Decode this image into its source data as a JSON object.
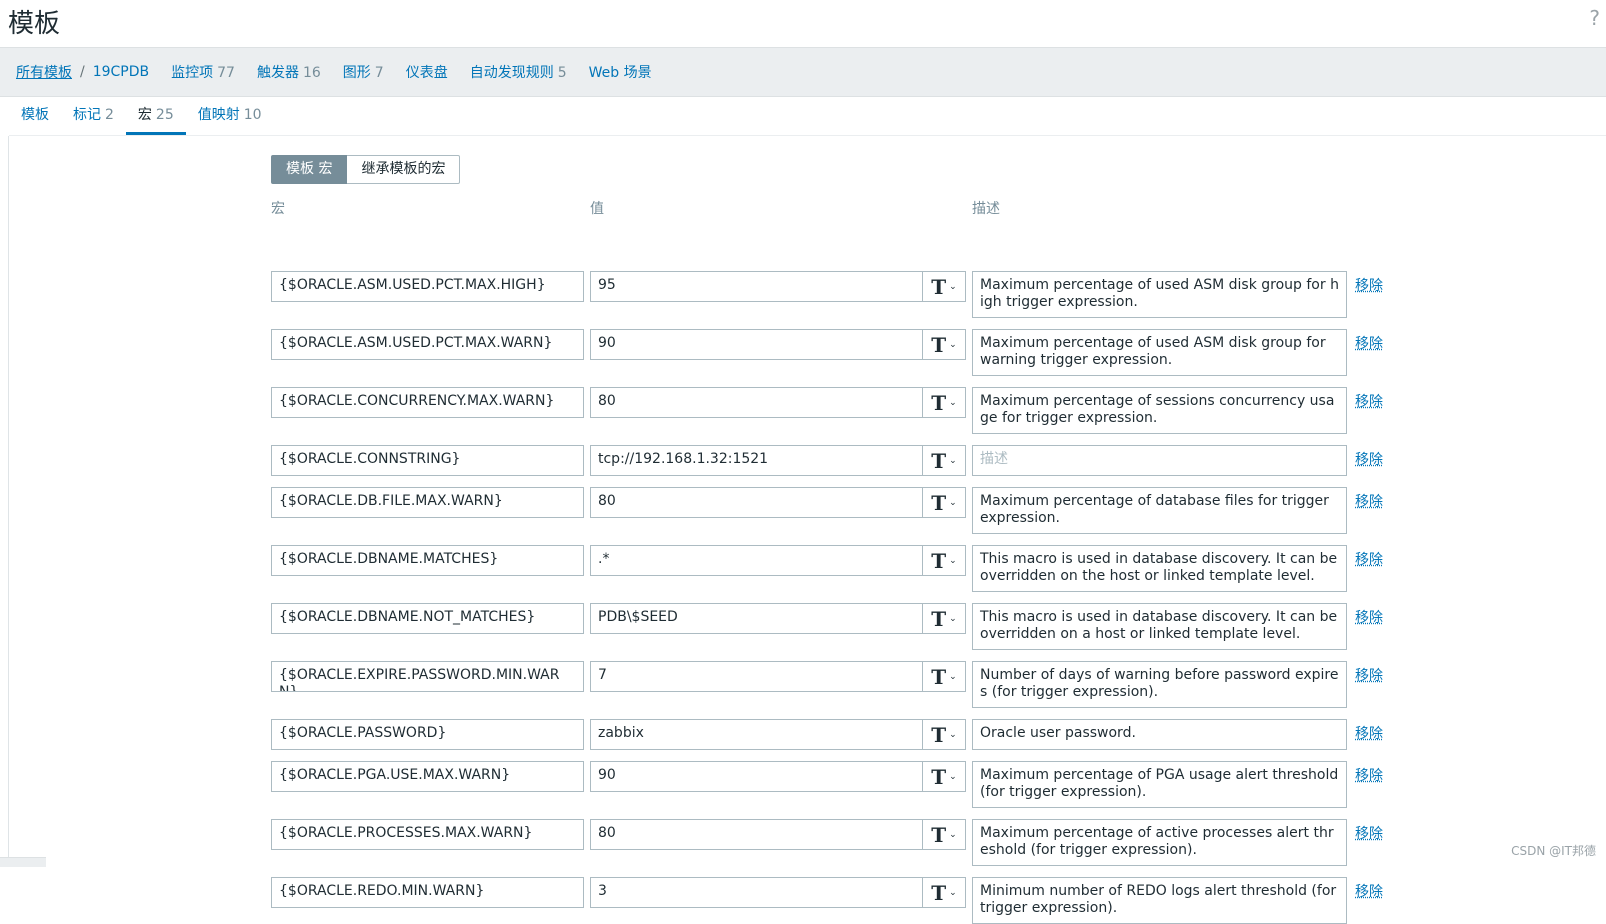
{
  "page": {
    "title": "模板",
    "help": "?"
  },
  "nav": {
    "all_templates": "所有模板",
    "sep": "/",
    "current": "19CPDB",
    "items": [
      {
        "label": "监控项",
        "count": "77"
      },
      {
        "label": "触发器",
        "count": "16"
      },
      {
        "label": "图形",
        "count": "7"
      },
      {
        "label": "仪表盘",
        "count": ""
      },
      {
        "label": "自动发现规则",
        "count": "5"
      },
      {
        "label": "Web 场景",
        "count": ""
      }
    ]
  },
  "tabs": [
    {
      "label": "模板",
      "count": ""
    },
    {
      "label": "标记",
      "count": "2"
    },
    {
      "label": "宏",
      "count": "25"
    },
    {
      "label": "值映射",
      "count": "10"
    }
  ],
  "macro_toggle": {
    "template": "模板 宏",
    "inherited": "继承模板的宏"
  },
  "columns": {
    "macro": "宏",
    "value": "值",
    "description": "描述"
  },
  "desc_placeholder": "描述",
  "remove_label": "移除",
  "macros": [
    {
      "macro": "{$ORACLE.ASM.USED.PCT.MAX.HIGH}",
      "value": "95",
      "description": "Maximum percentage of used ASM disk group for high trigger expression."
    },
    {
      "macro": "{$ORACLE.ASM.USED.PCT.MAX.WARN}",
      "value": "90",
      "description": "Maximum percentage of used ASM disk group for warning trigger expression."
    },
    {
      "macro": "{$ORACLE.CONCURRENCY.MAX.WARN}",
      "value": "80",
      "description": "Maximum percentage of sessions concurrency usage for trigger expression."
    },
    {
      "macro": "{$ORACLE.CONNSTRING}",
      "value": "tcp://192.168.1.32:1521",
      "description": ""
    },
    {
      "macro": "{$ORACLE.DB.FILE.MAX.WARN}",
      "value": "80",
      "description": "Maximum percentage of database files for trigger expression."
    },
    {
      "macro": "{$ORACLE.DBNAME.MATCHES}",
      "value": ".*",
      "description": "This macro is used in database discovery. It can be overridden on the host or linked template level."
    },
    {
      "macro": "{$ORACLE.DBNAME.NOT_MATCHES}",
      "value": "PDB\\$SEED",
      "description": "This macro is used in database discovery. It can be overridden on a host or linked template level."
    },
    {
      "macro": "{$ORACLE.EXPIRE.PASSWORD.MIN.WARN}",
      "value": "7",
      "description": "Number of days of warning before password expires (for trigger expression)."
    },
    {
      "macro": "{$ORACLE.PASSWORD}",
      "value": "zabbix",
      "description": "Oracle user password."
    },
    {
      "macro": "{$ORACLE.PGA.USE.MAX.WARN}",
      "value": "90",
      "description": "Maximum percentage of PGA usage alert threshold (for trigger expression)."
    },
    {
      "macro": "{$ORACLE.PROCESSES.MAX.WARN}",
      "value": "80",
      "description": "Maximum percentage of active processes alert threshold (for trigger expression)."
    },
    {
      "macro": "{$ORACLE.REDO.MIN.WARN}",
      "value": "3",
      "description": "Minimum number of REDO logs alert threshold (for trigger expression)."
    }
  ],
  "watermark": "CSDN @IT邦德"
}
